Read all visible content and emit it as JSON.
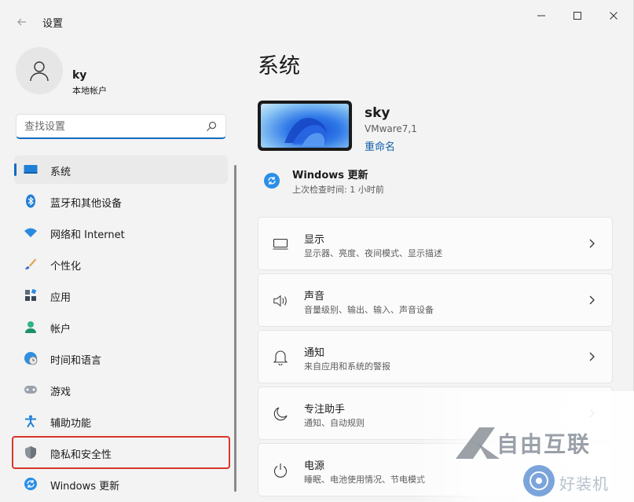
{
  "titlebar": {
    "title": "设置",
    "back_icon": "back-arrow-icon",
    "minimize_icon": "minimize-icon",
    "maximize_icon": "maximize-icon",
    "close_icon": "close-icon"
  },
  "user": {
    "name": "ky",
    "account_type": "本地帐户"
  },
  "search": {
    "placeholder": "查找设置",
    "value": ""
  },
  "sidebar": {
    "items": [
      {
        "label": "系统",
        "icon": "monitor-icon",
        "selected": true
      },
      {
        "label": "蓝牙和其他设备",
        "icon": "bluetooth-icon"
      },
      {
        "label": "网络和 Internet",
        "icon": "wifi-icon"
      },
      {
        "label": "个性化",
        "icon": "brush-icon"
      },
      {
        "label": "应用",
        "icon": "apps-icon"
      },
      {
        "label": "帐户",
        "icon": "person-icon"
      },
      {
        "label": "时间和语言",
        "icon": "clock-globe-icon"
      },
      {
        "label": "游戏",
        "icon": "gamepad-icon"
      },
      {
        "label": "辅助功能",
        "icon": "accessibility-icon"
      },
      {
        "label": "隐私和安全性",
        "icon": "shield-icon",
        "highlighted": true
      },
      {
        "label": "Windows 更新",
        "icon": "update-icon"
      }
    ]
  },
  "main": {
    "title": "系统",
    "device": {
      "name": "sky",
      "model": "VMware7,1",
      "rename_link": "重命名"
    },
    "update": {
      "title": "Windows 更新",
      "subtitle": "上次检查时间: 1 小时前"
    },
    "cards": [
      {
        "title": "显示",
        "subtitle": "显示器、亮度、夜间模式、显示描述",
        "icon": "display-icon"
      },
      {
        "title": "声音",
        "subtitle": "音量级别、输出、输入、声音设备",
        "icon": "speaker-icon"
      },
      {
        "title": "通知",
        "subtitle": "来自应用和系统的警报",
        "icon": "bell-icon"
      },
      {
        "title": "专注助手",
        "subtitle": "通知、自动规则",
        "icon": "moon-icon"
      },
      {
        "title": "电源",
        "subtitle": "睡眠、电池使用情况、节电模式",
        "icon": "power-icon"
      }
    ]
  },
  "watermark": {
    "main_text": "自由互联",
    "secondary_text": "好装机"
  },
  "colors": {
    "accent": "#0f6cbd",
    "highlight_border": "#d9352b",
    "background": "#f3f3f3"
  }
}
